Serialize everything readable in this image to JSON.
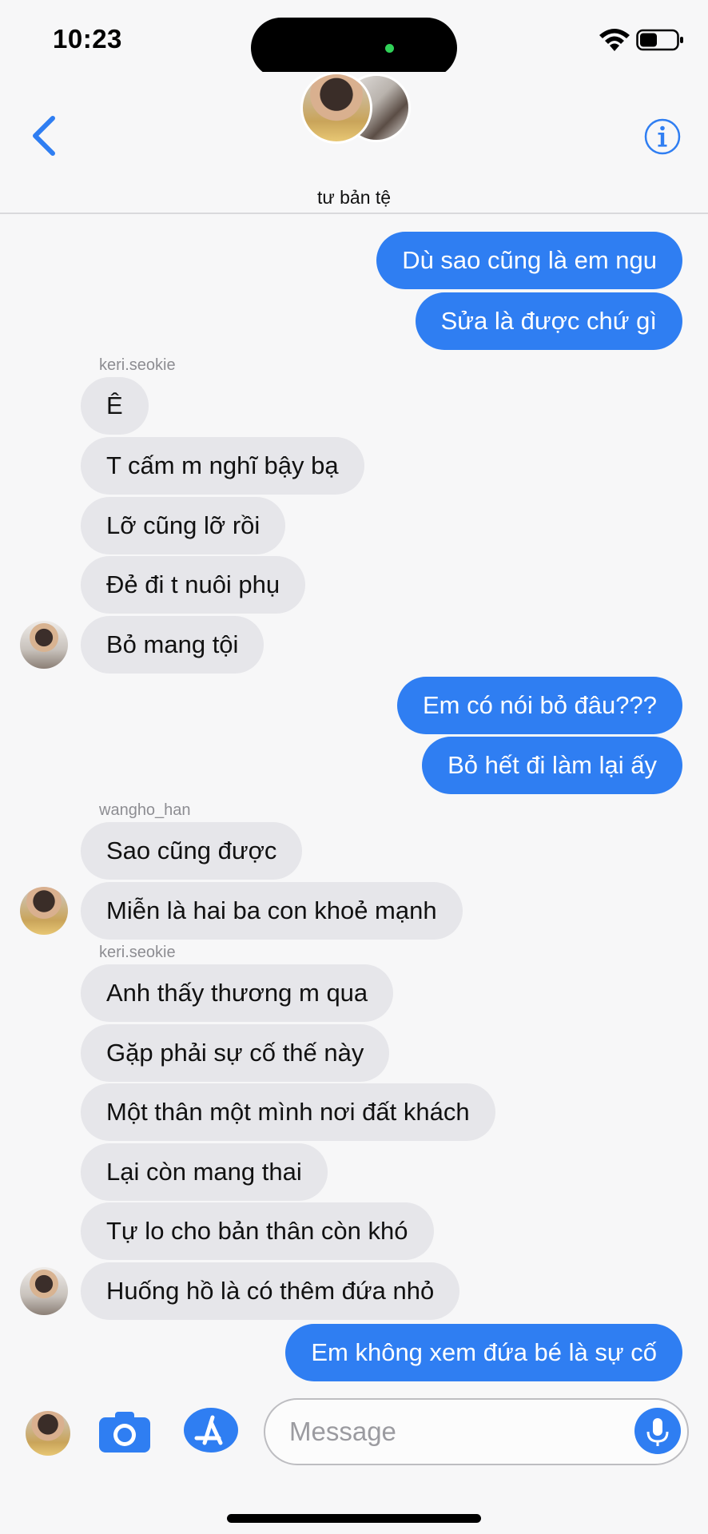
{
  "status_bar": {
    "time": "10:23"
  },
  "header": {
    "title": "tư bản tệ"
  },
  "messages": [
    {
      "dir": "out",
      "text": "Dù sao cũng là em ngu"
    },
    {
      "dir": "out",
      "text": "Sửa là được chứ gì"
    },
    {
      "sender": "keri.seokie"
    },
    {
      "dir": "in",
      "text": "Ê"
    },
    {
      "dir": "in",
      "text": "T cấm m nghĩ bậy bạ"
    },
    {
      "dir": "in",
      "text": "Lỡ cũng lỡ rồi"
    },
    {
      "dir": "in",
      "text": "Đẻ đi t nuôi phụ"
    },
    {
      "dir": "in",
      "text": "Bỏ mang tội"
    },
    {
      "dir": "out",
      "text": "Em có nói bỏ đâu???"
    },
    {
      "dir": "out",
      "text": "Bỏ hết đi làm lại ấy"
    },
    {
      "sender": "wangho_han"
    },
    {
      "dir": "in",
      "text": "Sao cũng được"
    },
    {
      "dir": "in",
      "text": "Miễn là hai ba con khoẻ mạnh"
    },
    {
      "sender": "keri.seokie"
    },
    {
      "dir": "in",
      "text": "Anh thấy thương m qua"
    },
    {
      "dir": "in",
      "text": "Gặp phải sự cố thế này"
    },
    {
      "dir": "in",
      "text": "Một thân một mình nơi đất khách"
    },
    {
      "dir": "in",
      "text": "Lại còn mang thai"
    },
    {
      "dir": "in",
      "text": "Tự lo cho bản thân còn khó"
    },
    {
      "dir": "in",
      "text": "Huống hồ là có thêm đứa nhỏ"
    },
    {
      "dir": "out",
      "text": "Em không xem đứa bé là sự cố"
    }
  ],
  "input": {
    "placeholder": "Message"
  },
  "colors": {
    "accent": "#2f7ef2",
    "incoming_bubble": "#e6e6ea",
    "background": "#f7f7f8"
  }
}
